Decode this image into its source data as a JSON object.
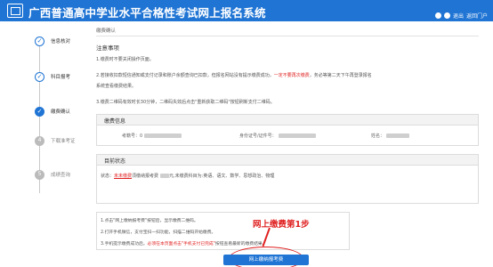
{
  "header": {
    "title": "广西普通高中学业水平合格性考试网上报名系统",
    "exit_link": "退出",
    "home_link": "返回门户"
  },
  "steps": [
    {
      "label": "信息核对",
      "status": "done"
    },
    {
      "label": "科目报考",
      "status": "done"
    },
    {
      "label": "缴费确认",
      "status": "current"
    },
    {
      "label": "下载准考证",
      "status": "todo",
      "number": "4"
    },
    {
      "label": "成绩查询",
      "status": "todo",
      "number": "5"
    }
  ],
  "main": {
    "title": "缴费确认",
    "notice_title": "注意事项",
    "notices": [
      {
        "text": "1.缴费时不要关闭操作页面。"
      },
      {
        "text": "2.若接收扣款短信通知或支付记录和账户余额查询已扣款，但报名网站没有提示缴费成功，",
        "red": "一定不要再次缴费",
        "tail": "，务必等第二天下午再登录报名"
      },
      {
        "text": "系统查看缴费结果。"
      },
      {
        "text": "3.缴费二维码有效时长30分钟，二维码失效后点击\"重新获取二维码\"按钮刷新支付二维码。"
      }
    ],
    "info_panel": {
      "heading": "缴费信息",
      "exam_no_label": "考籍号：",
      "exam_no_value": "0",
      "id_label": "身份证号/证件号：",
      "name_label": "姓名："
    },
    "status_panel": {
      "heading": "目前状态",
      "prefix": "状态：",
      "status_red": "未未缴费",
      "rest": "须缴纳报考费",
      "rest2": "元,未缴费科目为:英语、语文、数学、思想政治、物理"
    },
    "instructions": [
      {
        "text": "1.点击\"网上缴纳报考费\"按钮后，显示缴费二维码。"
      },
      {
        "text": "2.打开手机微信，支付宝扫一扫功能，扫描二维码开始缴费。"
      },
      {
        "text": "3.手机提示缴费成功后，",
        "red": "必须在本页面点击\"手机支付已完成\"",
        "tail": "按钮查看最新的缴费结果。"
      }
    ],
    "pay_button": "网上缴纳报考费",
    "annotation": "网上缴费第1步"
  },
  "colors": {
    "brand": "#1f74d4",
    "alert": "#e02020"
  }
}
